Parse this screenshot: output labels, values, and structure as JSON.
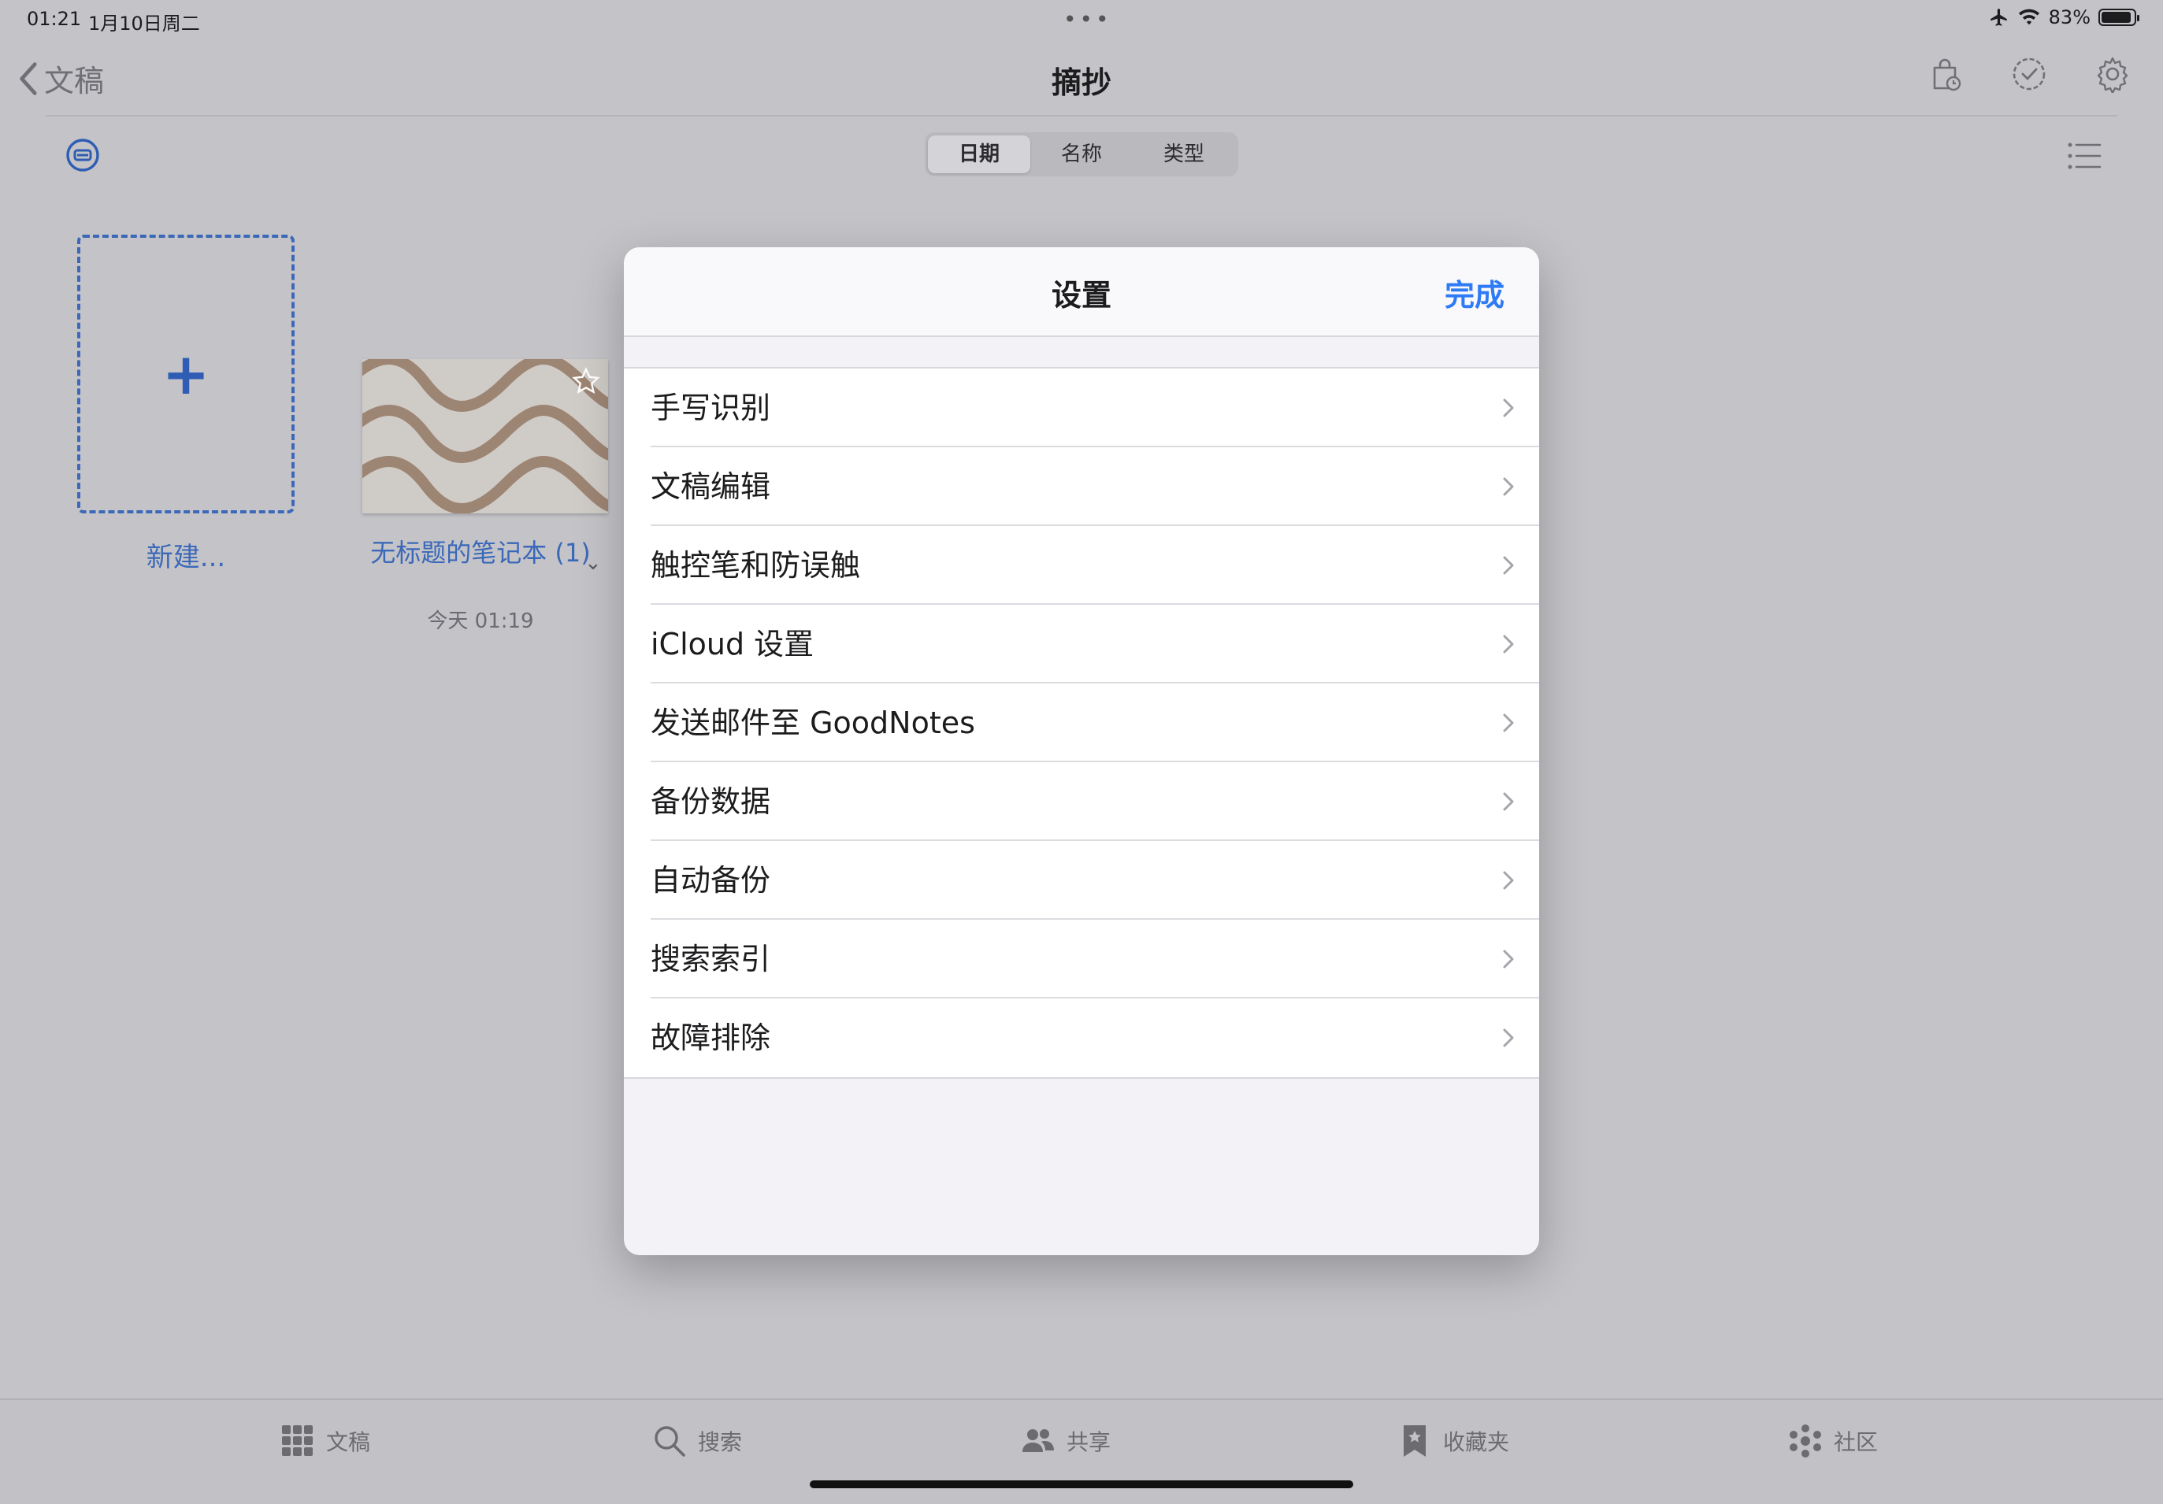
{
  "status": {
    "time": "01:21",
    "date": "1月10日周二",
    "battery": "83%",
    "battery_level": 0.83,
    "icons": [
      "airplane-icon",
      "wifi-icon",
      "battery-icon"
    ]
  },
  "nav": {
    "back_label": "文稿",
    "title": "摘抄",
    "icons": [
      "bag-clock-icon",
      "checkmark-circle-icon",
      "gear-icon"
    ]
  },
  "sort": {
    "options": [
      "日期",
      "名称",
      "类型"
    ],
    "selected": "日期"
  },
  "documents": {
    "new_label": "新建...",
    "notebook_title": "无标题的笔记本 (1)",
    "notebook_date": "今天 01:19"
  },
  "modal": {
    "title": "设置",
    "done_label": "完成",
    "items": [
      "手写识别",
      "文稿编辑",
      "触控笔和防误触",
      "iCloud 设置",
      "发送邮件至 GoodNotes",
      "备份数据",
      "自动备份",
      "搜索索引",
      "故障排除"
    ]
  },
  "tabbar": {
    "items": [
      "文稿",
      "搜索",
      "共享",
      "收藏夹",
      "社区"
    ],
    "icons": [
      "grid-icon",
      "search-icon",
      "people-icon",
      "bookmark-star-icon",
      "community-icon"
    ]
  },
  "colors": {
    "accent": "#2f7bf5",
    "link": "#3b68b8",
    "background": "#c4c4c8"
  }
}
